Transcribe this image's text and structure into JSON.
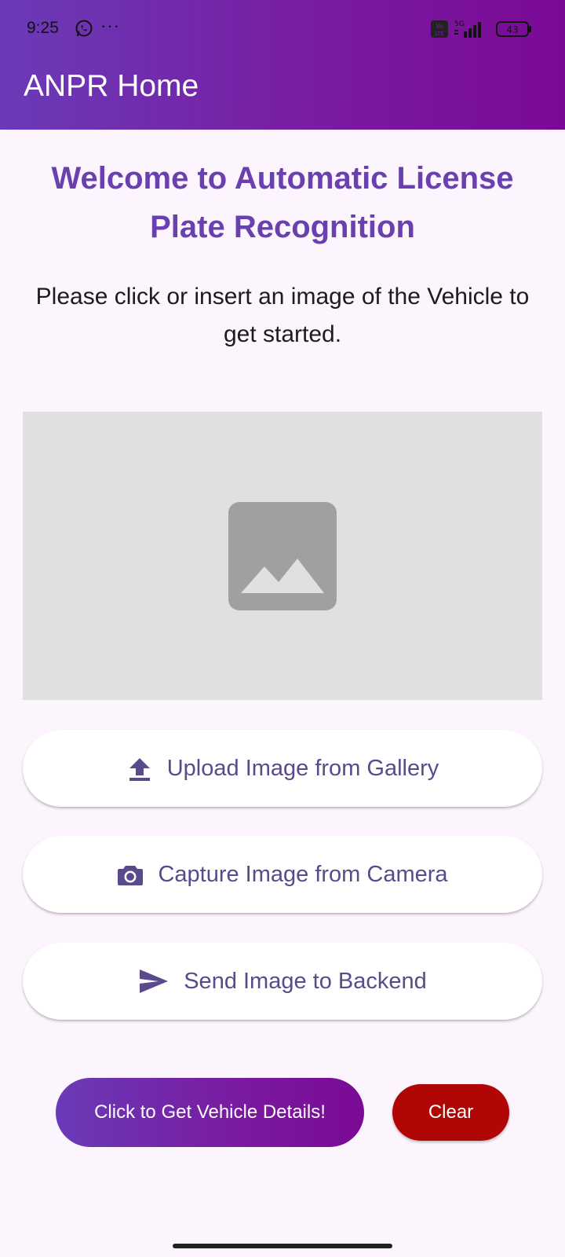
{
  "status_bar": {
    "time": "9:25",
    "overflow": "···",
    "network": "5G",
    "battery": "43",
    "icons": [
      "whatsapp-icon",
      "volte-icon",
      "signal-icon",
      "battery-icon"
    ]
  },
  "app_bar": {
    "title": "ANPR Home"
  },
  "main": {
    "welcome": "Welcome to Automatic License Plate Recognition",
    "instructions": "Please click or insert an image of the Vehicle to get started.",
    "image_placeholder_icon": "image-icon"
  },
  "actions": {
    "upload_label": "Upload Image from Gallery",
    "upload_icon": "upload-icon",
    "camera_label": "Capture Image from Camera",
    "camera_icon": "camera-icon",
    "send_label": "Send Image to Backend",
    "send_icon": "send-icon"
  },
  "bottom": {
    "details_label": "Click to Get Vehicle Details!",
    "clear_label": "Clear"
  },
  "colors": {
    "primary": "#6a40b0",
    "gradient_start": "#6a3ab8",
    "gradient_end": "#7a0a96",
    "danger": "#b00606",
    "button_text": "#5a4a8c",
    "placeholder_bg": "#e0e0e0"
  }
}
